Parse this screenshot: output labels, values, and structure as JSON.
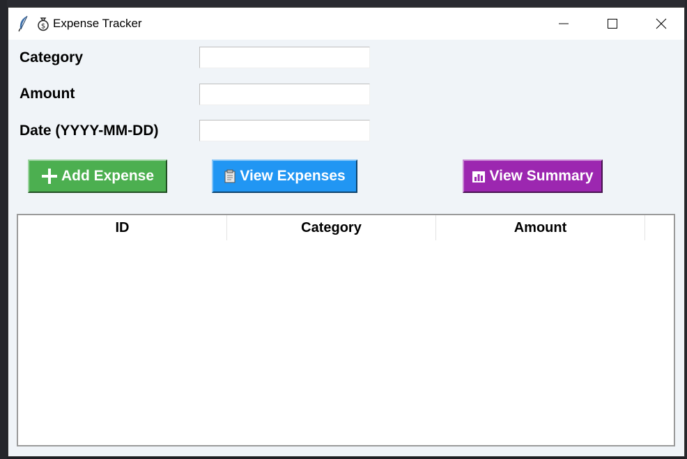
{
  "window": {
    "title": "Expense Tracker",
    "controls": [
      "minimize",
      "maximize",
      "close"
    ]
  },
  "form": {
    "category_label": "Category",
    "category_value": "",
    "amount_label": "Amount",
    "amount_value": "",
    "date_label": "Date (YYYY-MM-DD)",
    "date_value": ""
  },
  "buttons": {
    "add_label": "Add Expense",
    "add_icon": "plus-icon",
    "add_color": "#4caf50",
    "view_label": "View Expenses",
    "view_icon": "clipboard-icon",
    "view_color": "#2196f3",
    "summary_label": "View Summary",
    "summary_icon": "bar-chart-icon",
    "summary_color": "#9c27b0"
  },
  "table": {
    "columns": [
      "ID",
      "Category",
      "Amount"
    ],
    "rows": []
  }
}
